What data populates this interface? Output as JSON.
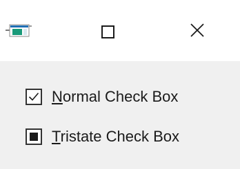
{
  "titlebar": {
    "icon": "app-window-icon",
    "buttons": [
      {
        "name": "maximize",
        "icon": "maximize-icon"
      },
      {
        "name": "close",
        "icon": "close-icon"
      }
    ]
  },
  "checkboxes": [
    {
      "mnemonic": "N",
      "rest": "ormal Check Box",
      "state": "checked"
    },
    {
      "mnemonic": "T",
      "rest": "ristate Check Box",
      "state": "indeterminate"
    }
  ],
  "colors": {
    "client_background": "#f0f0f0",
    "titlebar_background": "#ffffff",
    "text": "#1a1a1a"
  }
}
